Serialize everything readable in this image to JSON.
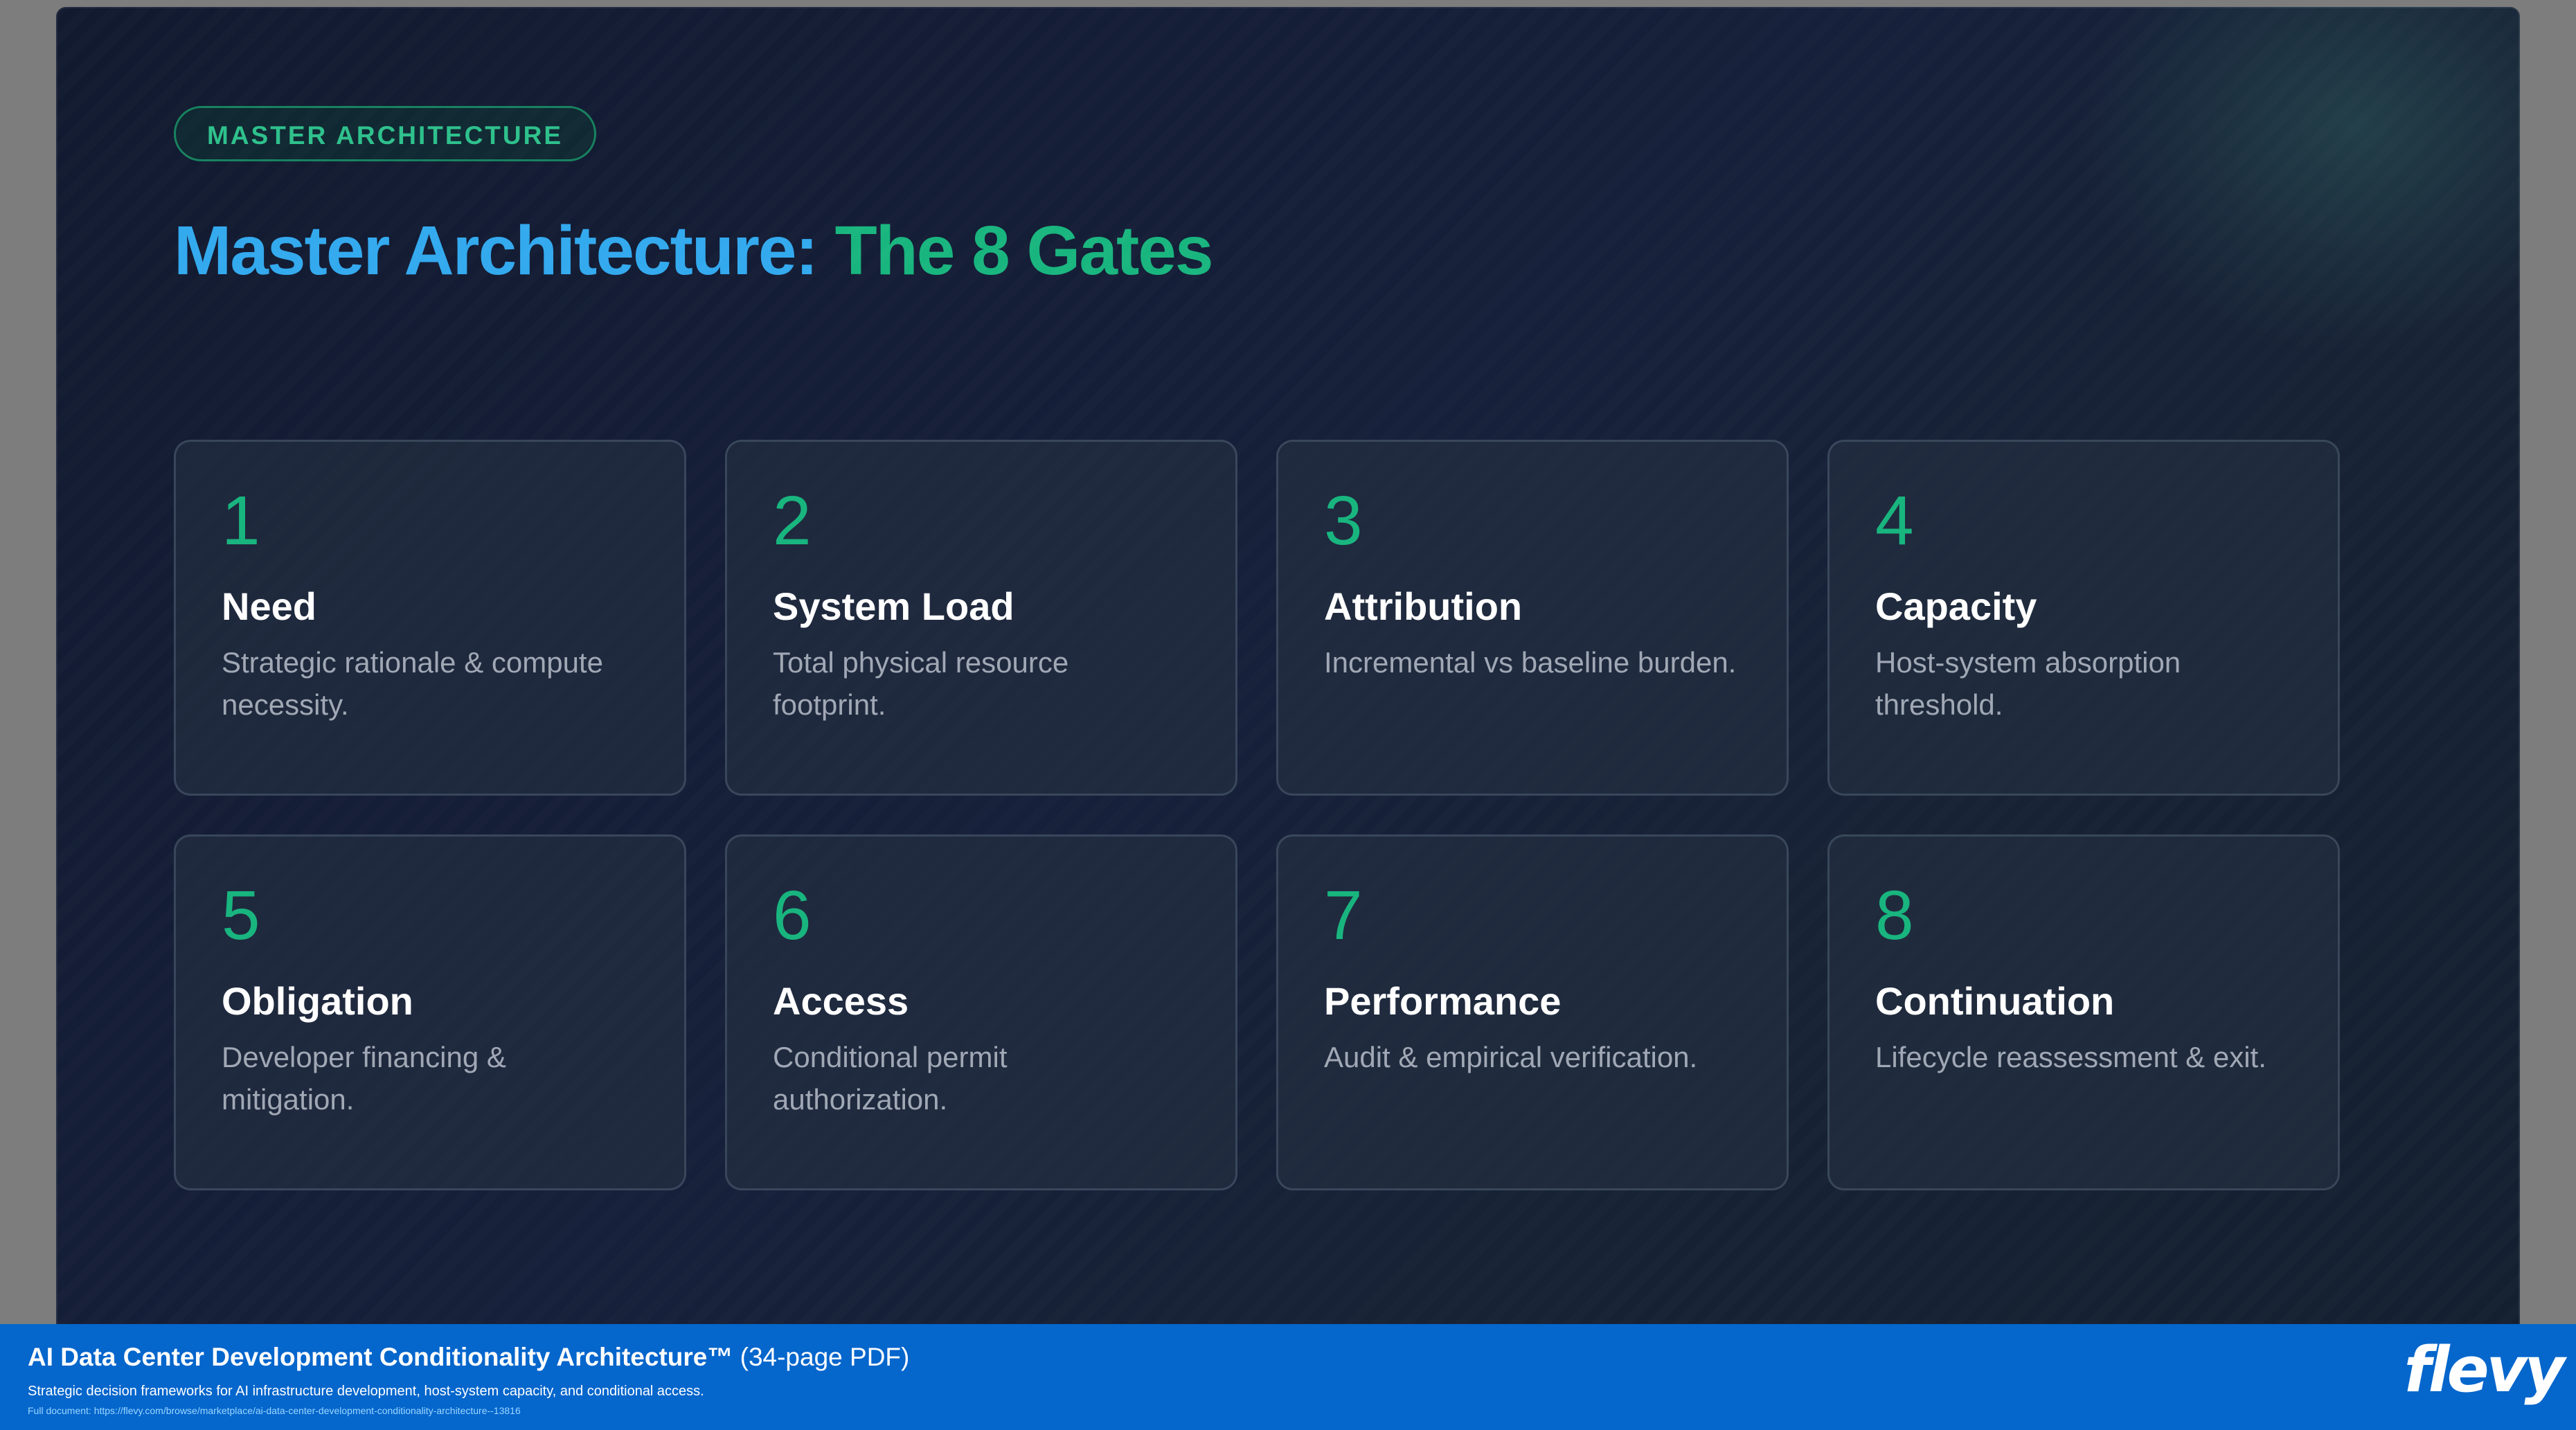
{
  "slide": {
    "badge": "MASTER ARCHITECTURE",
    "title_part1": "Master Architecture: ",
    "title_part2": "The 8 Gates"
  },
  "gates": [
    {
      "number": "1",
      "title": "Need",
      "description": "Strategic rationale & compute necessity."
    },
    {
      "number": "2",
      "title": "System Load",
      "description": "Total physical resource footprint."
    },
    {
      "number": "3",
      "title": "Attribution",
      "description": "Incremental vs baseline burden."
    },
    {
      "number": "4",
      "title": "Capacity",
      "description": "Host-system absorption threshold."
    },
    {
      "number": "5",
      "title": "Obligation",
      "description": "Developer financing & mitigation."
    },
    {
      "number": "6",
      "title": "Access",
      "description": "Conditional permit authorization."
    },
    {
      "number": "7",
      "title": "Performance",
      "description": "Audit & empirical verification."
    },
    {
      "number": "8",
      "title": "Continuation",
      "description": "Lifecycle reassessment & exit."
    }
  ],
  "footer": {
    "title": "AI Data Center Development Conditionality Architecture™",
    "page_count": " (34-page PDF)",
    "subtitle": "Strategic decision frameworks for AI infrastructure development, host-system capacity, and conditional access.",
    "url": "Full document: https://flevy.com/browse/marketplace/ai-data-center-development-conditionality-architecture--13816",
    "logo": "flevy"
  },
  "colors": {
    "background": "#131b31",
    "accent_green": "#19b57f",
    "accent_blue": "#33a9ee",
    "footer_blue": "#0566cc"
  }
}
